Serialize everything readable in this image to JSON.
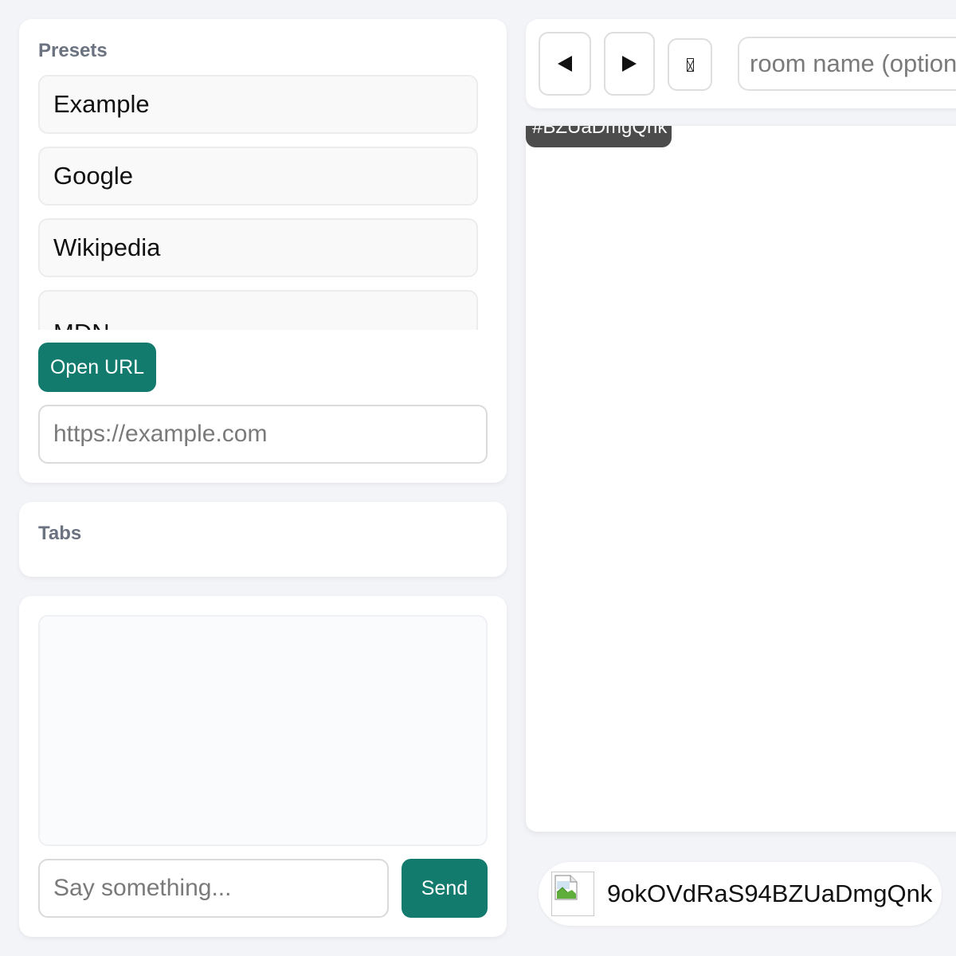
{
  "presets": {
    "title": "Presets",
    "items": [
      {
        "label": "Example"
      },
      {
        "label": "Google"
      },
      {
        "label": "Wikipedia"
      },
      {
        "label": "MDN"
      }
    ],
    "open_url_label": "Open URL",
    "url_placeholder": "https://example.com"
  },
  "tabs": {
    "title": "Tabs"
  },
  "chat": {
    "message_placeholder": "Say something...",
    "send_label": "Send"
  },
  "toolbar": {
    "back_icon": "back-arrow-icon",
    "forward_icon": "forward-arrow-icon",
    "extra_icon": "missing-glyph-icon",
    "room_placeholder": "room name (optional)"
  },
  "viewer": {
    "tag": "#BZUaDmgQnk"
  },
  "user": {
    "name": "9okOVdRaS94BZUaDmgQnk"
  },
  "colors": {
    "accent": "#137a6e",
    "background": "#f3f4f8",
    "tag_bg": "#4c4c4c"
  }
}
